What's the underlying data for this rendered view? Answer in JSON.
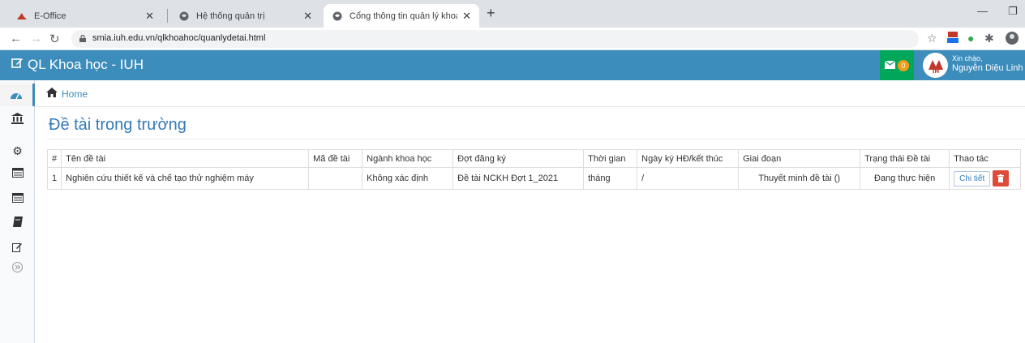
{
  "browser": {
    "tabs": [
      {
        "title": "E-Office",
        "icon": "eoffice-favicon"
      },
      {
        "title": "Hệ thống quản trị",
        "icon": "globe-icon"
      },
      {
        "title": "Cổng thông tin quản lý khoa học",
        "icon": "globe-icon"
      }
    ],
    "url": "smia.iuh.edu.vn/qlkhoahoc/quanlydetai.html",
    "new_tab_symbol": "+",
    "close_symbol": "✕"
  },
  "header": {
    "brand": "QL Khoa học - IUH",
    "mail_count": "0",
    "greeting": "Xin chào,",
    "username": "Nguyễn Diệu Linh"
  },
  "sidebar": {
    "items": [
      {
        "icon": "dashboard-icon",
        "symbol": "◉"
      },
      {
        "icon": "institution-icon",
        "symbol": "🏛"
      },
      {
        "icon": "gear-icon",
        "symbol": "⚙"
      },
      {
        "icon": "list-icon",
        "symbol": "▤"
      },
      {
        "icon": "list-icon",
        "symbol": "▤"
      },
      {
        "icon": "book-icon",
        "symbol": "▰"
      },
      {
        "icon": "edit-icon",
        "symbol": "✎"
      },
      {
        "icon": "collapse-icon",
        "symbol": "»"
      }
    ]
  },
  "breadcrumb": {
    "home": "Home"
  },
  "page": {
    "title": "Đề tài trong trường"
  },
  "table": {
    "headers": [
      "#",
      "Tên đề tài",
      "Mã đề tài",
      "Ngành khoa học",
      "Đợt đăng ký",
      "Thời gian",
      "Ngày ký HĐ/kết thúc",
      "Giai đoạn",
      "Trạng thái Đề tài",
      "Thao tác"
    ],
    "rows": [
      {
        "index": "1",
        "name": "Nghiên cứu thiết kế và chế tạo thử nghiệm máy",
        "code": "",
        "field": "Không xác định",
        "round": "Đề tài NCKH Đợt 1_2021",
        "duration": "tháng",
        "dates": "/",
        "stage": "Thuyết minh đề tài ()",
        "status": "Đang thực hiện",
        "detail_label": "Chi tiết"
      }
    ]
  },
  "colors": {
    "header": "#3c8dbc",
    "mail": "#00a65a",
    "delete": "#dd4b39",
    "title": "#337ab7"
  }
}
